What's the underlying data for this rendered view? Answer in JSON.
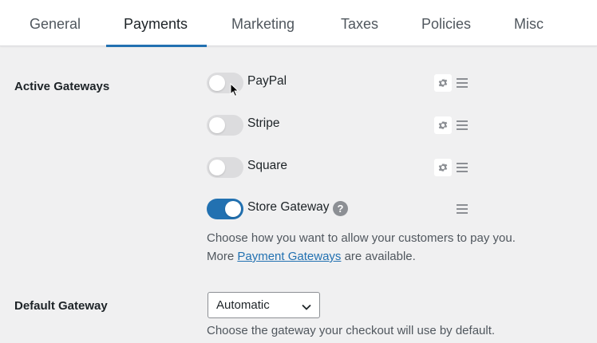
{
  "tabs": [
    {
      "label": "General"
    },
    {
      "label": "Payments"
    },
    {
      "label": "Marketing"
    },
    {
      "label": "Taxes"
    },
    {
      "label": "Policies"
    },
    {
      "label": "Misc"
    }
  ],
  "active_tab": "Payments",
  "active_gateways": {
    "label": "Active Gateways",
    "gateways": [
      {
        "name": "PayPal",
        "enabled": false,
        "has_settings": true
      },
      {
        "name": "Stripe",
        "enabled": false,
        "has_settings": true
      },
      {
        "name": "Square",
        "enabled": false,
        "has_settings": true
      },
      {
        "name": "Store Gateway",
        "enabled": true,
        "has_settings": false,
        "help_icon": "?"
      }
    ],
    "description_line1": "Choose how you want to allow your customers to pay you.",
    "description_more": "More",
    "description_link": "Payment Gateways",
    "description_end": "are available."
  },
  "default_gateway": {
    "label": "Default Gateway",
    "selected": "Automatic",
    "description": "Choose the gateway your checkout will use by default."
  },
  "colors": {
    "accent": "#2271b1",
    "background": "#f0f0f1",
    "toggle_off": "#dcdcde"
  },
  "icons": {
    "settings": "gear-icon",
    "reorder": "drag-handle-icon",
    "help": "help-icon",
    "dropdown": "chevron-down-icon"
  }
}
